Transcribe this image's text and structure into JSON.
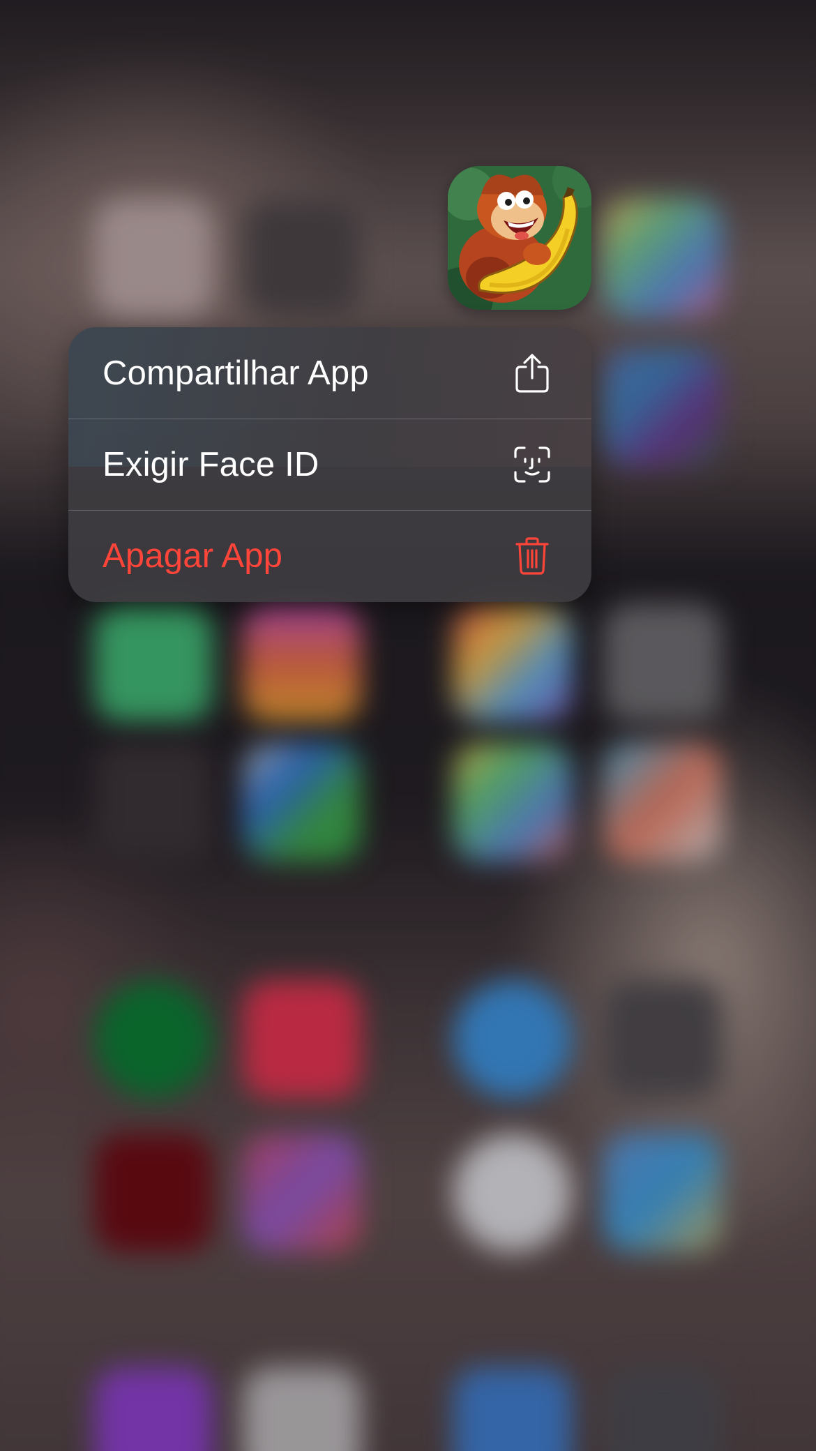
{
  "app": {
    "icon_name": "banana-kong-app-icon"
  },
  "context_menu": {
    "items": [
      {
        "label": "Compartilhar App",
        "icon": "share-icon",
        "destructive": false
      },
      {
        "label": "Exigir Face ID",
        "icon": "face-id-icon",
        "destructive": false
      },
      {
        "label": "Apagar App",
        "icon": "trash-icon",
        "destructive": true
      }
    ]
  },
  "colors": {
    "menu_text": "#ffffff",
    "destructive": "#ff453a",
    "menu_background": "#3e3c40"
  }
}
